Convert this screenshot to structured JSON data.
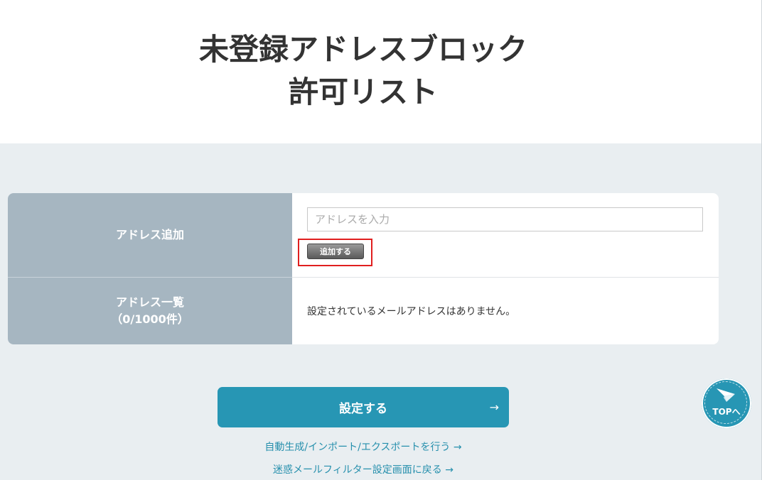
{
  "page": {
    "title_line1": "未登録アドレスブロック",
    "title_line2": "許可リスト"
  },
  "form": {
    "add_label": "アドレス追加",
    "input_placeholder": "アドレスを入力",
    "input_value": "",
    "add_button": "追加する",
    "list_label": "アドレス一覧",
    "list_count": "（0/1000件）",
    "empty_message": "設定されているメールアドレスはありません。"
  },
  "actions": {
    "submit_label": "設定する",
    "submit_arrow": "→",
    "link_auto": "自動生成/インポート/エクスポートを行う →",
    "link_back": "迷惑メールフィルター設定画面に戻る →"
  },
  "top_button": {
    "label": "TOPへ",
    "icon": "paper-plane-icon"
  },
  "colors": {
    "accent": "#2796b4",
    "label_bg": "#a6b6c1",
    "page_bg": "#e9eef1",
    "highlight": "#e01f1f"
  }
}
